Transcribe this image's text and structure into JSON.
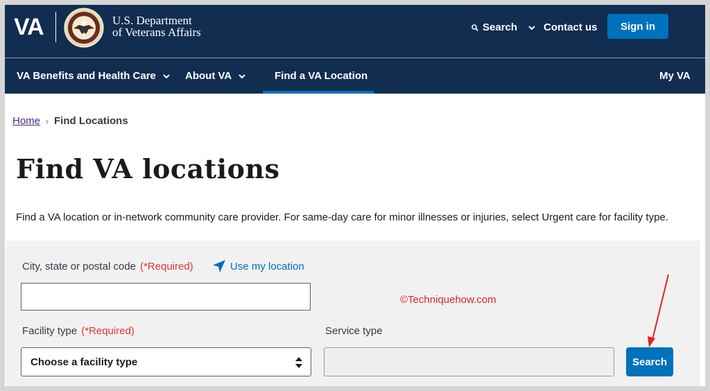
{
  "header": {
    "logo_text": "VA",
    "dept_line1": "U.S. Department",
    "dept_line2": "of Veterans Affairs",
    "search_label": "Search",
    "contact_label": "Contact us",
    "signin_label": "Sign in",
    "colors": {
      "background": "#112e51",
      "accent": "#0071bb"
    }
  },
  "nav": {
    "items": [
      {
        "label": "VA Benefits and Health Care"
      },
      {
        "label": "About VA"
      },
      {
        "label": "Find a VA Location"
      },
      {
        "label": "My VA"
      }
    ],
    "active": "Find a VA Location"
  },
  "breadcrumb": {
    "home": "Home",
    "current": "Find Locations"
  },
  "main": {
    "title": "Find VA locations",
    "intro": "Find a VA location or in-network community care provider. For same-day care for minor illnesses or injuries, select Urgent care for facility type."
  },
  "form": {
    "city_label": "City, state or postal code",
    "required_text": "(*Required)",
    "use_location": "Use my location",
    "city_value": "",
    "facility_label": "Facility type",
    "facility_selected": "Choose a facility type",
    "service_label": "Service type",
    "service_value": "",
    "search_button": "Search"
  },
  "watermark": "©Techniquehow.com"
}
